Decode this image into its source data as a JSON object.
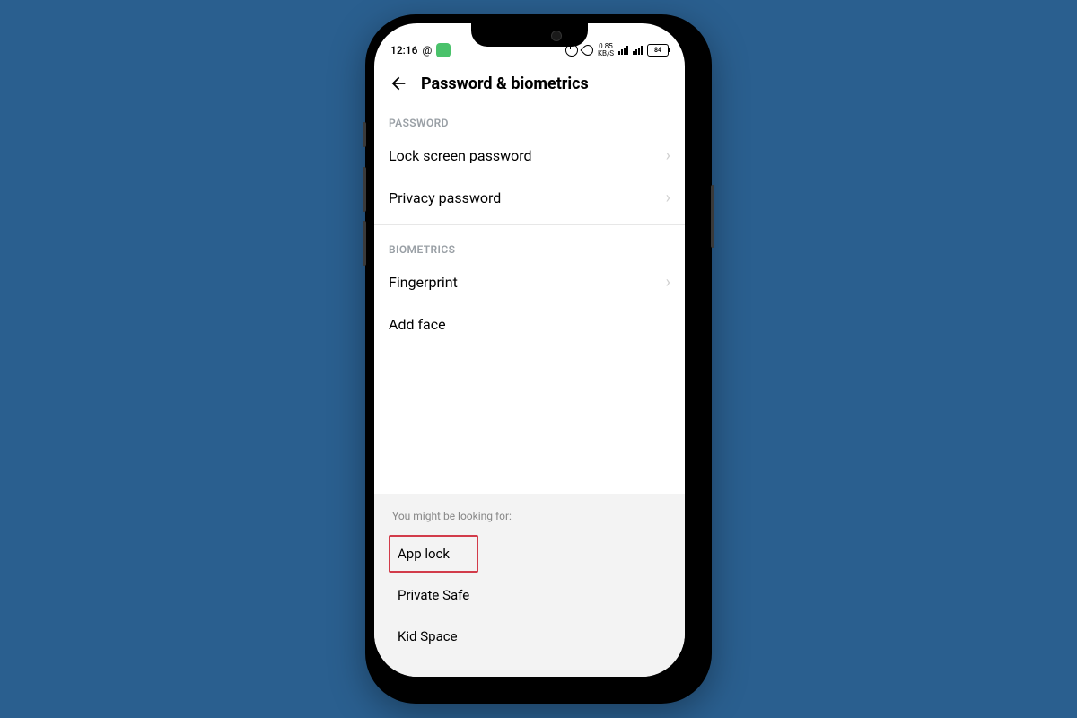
{
  "status": {
    "time": "12:16",
    "net_speed": "0.85",
    "net_unit": "KB/S",
    "battery": "84"
  },
  "header": {
    "title": "Password & biometrics"
  },
  "sections": {
    "password": {
      "label": "PASSWORD",
      "items": [
        "Lock screen password",
        "Privacy password"
      ]
    },
    "biometrics": {
      "label": "BIOMETRICS",
      "items": [
        "Fingerprint",
        "Add face"
      ]
    }
  },
  "footer": {
    "label": "You might be looking for:",
    "items": [
      "App lock",
      "Private Safe",
      "Kid Space"
    ],
    "highlight_index": 0
  }
}
